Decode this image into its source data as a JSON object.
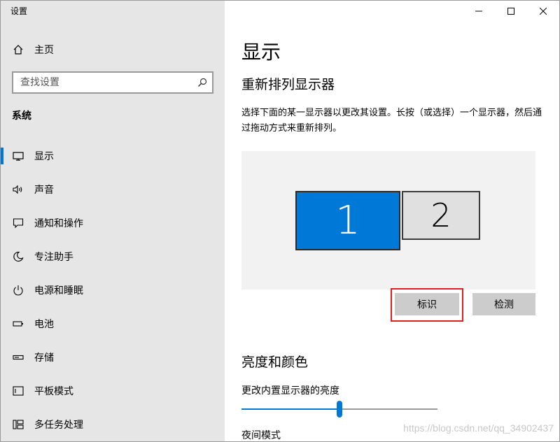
{
  "window": {
    "title": "设置"
  },
  "sidebar": {
    "home": {
      "label": "主页",
      "icon": "home-icon"
    },
    "search": {
      "placeholder": "查找设置",
      "icon": "search-icon"
    },
    "section_title": "系统",
    "items": [
      {
        "label": "显示",
        "icon": "monitor-icon",
        "active": true
      },
      {
        "label": "声音",
        "icon": "speaker-icon"
      },
      {
        "label": "通知和操作",
        "icon": "notification-icon"
      },
      {
        "label": "专注助手",
        "icon": "moon-icon"
      },
      {
        "label": "电源和睡眠",
        "icon": "power-icon"
      },
      {
        "label": "电池",
        "icon": "battery-icon"
      },
      {
        "label": "存储",
        "icon": "storage-icon"
      },
      {
        "label": "平板模式",
        "icon": "tablet-icon"
      },
      {
        "label": "多任务处理",
        "icon": "multitask-icon"
      }
    ]
  },
  "main": {
    "page_title": "显示",
    "rearrange": {
      "heading": "重新排列显示器",
      "description": "选择下面的某一显示器以更改其设置。长按（或选择）一个显示器，然后通过拖动方式来重新排列。",
      "monitors": [
        {
          "label": "1",
          "selected": true
        },
        {
          "label": "2",
          "selected": false
        }
      ],
      "identify_label": "标识",
      "detect_label": "检测"
    },
    "brightness": {
      "heading": "亮度和颜色",
      "label": "更改内置显示器的亮度",
      "value_percent": 50
    },
    "night_mode_label": "夜间模式"
  },
  "watermark": "https://blog.csdn.net/qq_34902437",
  "colors": {
    "accent": "#0078d7",
    "sidebar_bg": "#e6e6e6",
    "highlight": "#e02020"
  }
}
